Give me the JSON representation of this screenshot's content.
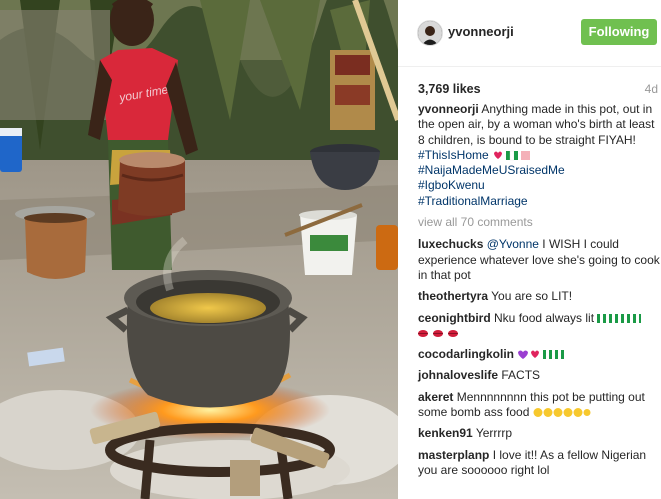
{
  "post": {
    "username": "yvonneorji",
    "follow_label": "Following",
    "likes": "3,769 likes",
    "age": "4d",
    "caption": {
      "username": "yvonneorji",
      "text": "Anything made in this pot, out in the open air, by a woman who's birth at least 8 children, is bound to be straight FIYAH!",
      "hashtags": [
        "#ThisIsHome",
        "#NaijaMadeMeUSraisedMe",
        "#IgboKwenu",
        "#TraditionalMarriage"
      ]
    },
    "view_all": "view all 70 comments"
  },
  "comments": [
    {
      "user": "luxechucks",
      "mention": "@Yvonne",
      "text": "I WISH I could experience whatever love she's going to cook in that pot"
    },
    {
      "user": "theothertyra",
      "text": "You are so LIT!"
    },
    {
      "user": "ceonightbird",
      "text": "Nku food always lit"
    },
    {
      "user": "cocodarlingkolin",
      "text": ""
    },
    {
      "user": "johnaloveslife",
      "text": "FACTS"
    },
    {
      "user": "akeret",
      "text": "Mennnnnnnn this pot be putting out some bomb ass food"
    },
    {
      "user": "kenken91",
      "text": "Yerrrrp"
    },
    {
      "user": "masterplanp",
      "text": "I love it!! As a fellow Nigerian you are soooooo right lol"
    }
  ],
  "photo": {
    "shirt_text": "your time"
  },
  "colors": {
    "follow_bg": "#70c050",
    "hashtag": "#003569",
    "muted": "#999999"
  }
}
